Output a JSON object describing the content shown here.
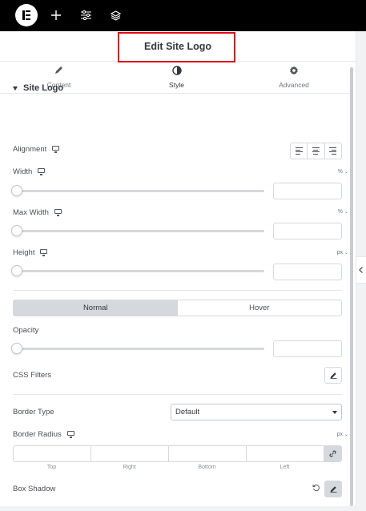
{
  "topbar": {
    "logo_icon": "elementor-logo-icon",
    "add_icon": "plus-icon",
    "settings_icon": "sliders-icon",
    "layers_icon": "layers-icon"
  },
  "panel": {
    "title": "Edit Site Logo",
    "tabs": [
      {
        "label": "Content",
        "icon": "pencil-icon"
      },
      {
        "label": "Style",
        "icon": "half-circle-icon",
        "active": true
      },
      {
        "label": "Advanced",
        "icon": "gear-icon"
      }
    ],
    "highlight_color": "#e20613"
  },
  "section": {
    "title": "Site Logo",
    "alignment_label": "Alignment",
    "width": {
      "label": "Width",
      "unit": "%",
      "value": ""
    },
    "max_width": {
      "label": "Max Width",
      "unit": "%",
      "value": ""
    },
    "height": {
      "label": "Height",
      "unit": "px",
      "value": ""
    },
    "state_tabs": {
      "normal": "Normal",
      "hover": "Hover"
    },
    "opacity": {
      "label": "Opacity",
      "value": ""
    },
    "css_filters_label": "CSS Filters",
    "border_type": {
      "label": "Border Type",
      "value": "Default"
    },
    "border_radius": {
      "label": "Border Radius",
      "unit": "px",
      "sides": [
        "Top",
        "Right",
        "Bottom",
        "Left"
      ]
    },
    "box_shadow_label": "Box Shadow"
  }
}
